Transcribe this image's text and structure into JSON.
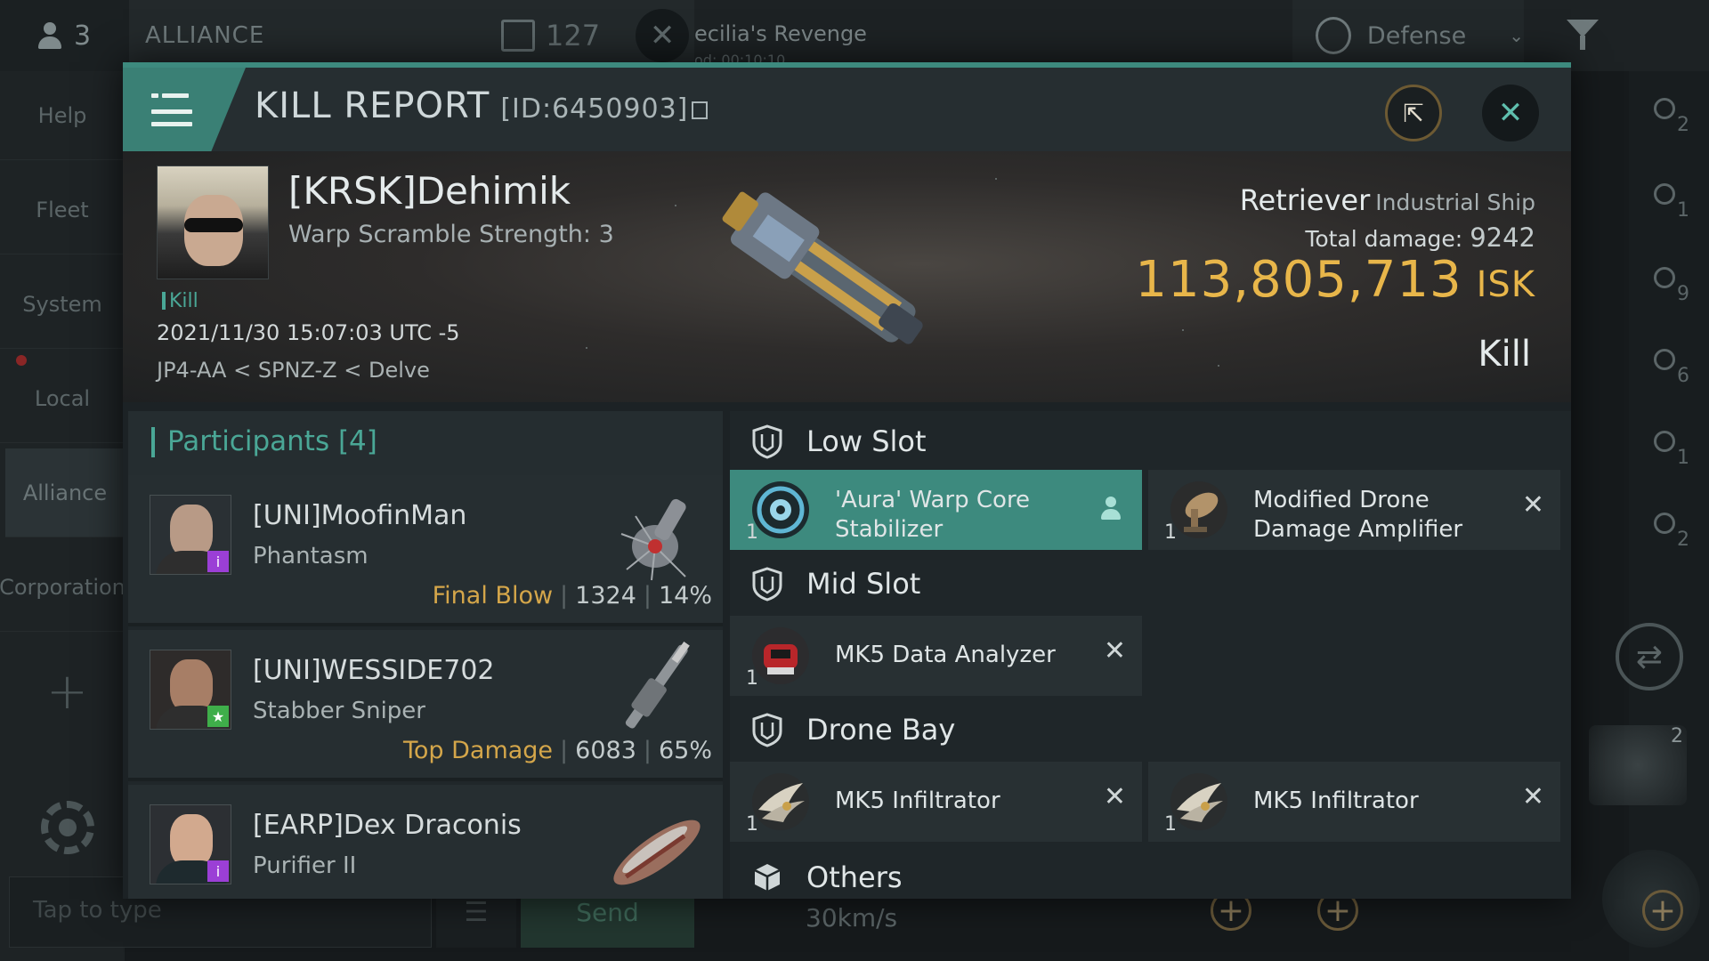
{
  "background": {
    "online_count": "3",
    "channel_label": "ALLIANCE",
    "chat_count": "127",
    "enemy_name": "ecilia's Revenge",
    "enemy_sub": "od: 00:10:10",
    "defense_label": "Defense",
    "sidebar": [
      "Help",
      "Fleet",
      "System",
      "Local",
      "Alliance",
      "Corporation"
    ],
    "chat_placeholder": "Tap to type",
    "send_label": "Send",
    "speed": "30km/s",
    "right_icons": [
      {
        "icon": "fleet-icon",
        "count": "2"
      },
      {
        "icon": "target-icon",
        "count": "1"
      },
      {
        "icon": "planet-icon",
        "count": "9"
      },
      {
        "icon": "group-icon",
        "count": "6"
      },
      {
        "icon": "structure-icon",
        "count": "1"
      },
      {
        "icon": "gate-icon",
        "count": "2"
      }
    ],
    "ship_thumb_count": "2"
  },
  "report": {
    "title": "KILL REPORT",
    "id": "[ID:6450903]"
  },
  "victim": {
    "name": "[KRSK]Dehimik",
    "warp_scramble": "Warp Scramble Strength: 3",
    "tag": "Kill",
    "datetime": "2021/11/30 15:07:03 UTC -5",
    "location": "JP4-AA < SPNZ-Z < Delve",
    "ship": "Retriever",
    "ship_class": "Industrial Ship",
    "total_damage_label": "Total damage:",
    "total_damage": "9242",
    "isk_value": "113,805,713",
    "isk_unit": "ISK",
    "result": "Kill"
  },
  "participants": {
    "title": "Participants [4]",
    "rows": [
      {
        "name": "[UNI]MoofinMan",
        "ship": "Phantasm",
        "tag": "Final Blow",
        "damage": "1324",
        "percent": "14%",
        "badge_color": "#9b3fd6"
      },
      {
        "name": "[UNI]WESSIDE702",
        "ship": "Stabber Sniper",
        "tag": "Top Damage",
        "damage": "6083",
        "percent": "65%",
        "badge_color": "#3fae4a"
      },
      {
        "name": "[EARP]Dex Draconis",
        "ship": "Purifier II",
        "tag": "",
        "damage": "",
        "percent": "",
        "badge_color": "#9b3fd6"
      }
    ]
  },
  "fittings": {
    "low_slot": {
      "label": "Low Slot",
      "modules": [
        {
          "name_1": "'Aura' Warp Core",
          "name_2": "Stabilizer",
          "qty": "1",
          "state": "dropped"
        },
        {
          "name_1": "Modified Drone",
          "name_2": "Damage Amplifier",
          "qty": "1",
          "state": "destroyed"
        }
      ]
    },
    "mid_slot": {
      "label": "Mid Slot",
      "modules": [
        {
          "name": "MK5 Data Analyzer",
          "qty": "1",
          "state": "destroyed"
        }
      ]
    },
    "drone_bay": {
      "label": "Drone Bay",
      "modules": [
        {
          "name": "MK5  Infiltrator",
          "qty": "1",
          "state": "destroyed"
        },
        {
          "name": "MK5  Infiltrator",
          "qty": "1",
          "state": "destroyed"
        }
      ]
    },
    "others": {
      "label": "Others"
    }
  },
  "colors": {
    "accent": "#3d8a7e",
    "isk": "#e8b64a",
    "tag": "#d4a64a"
  }
}
